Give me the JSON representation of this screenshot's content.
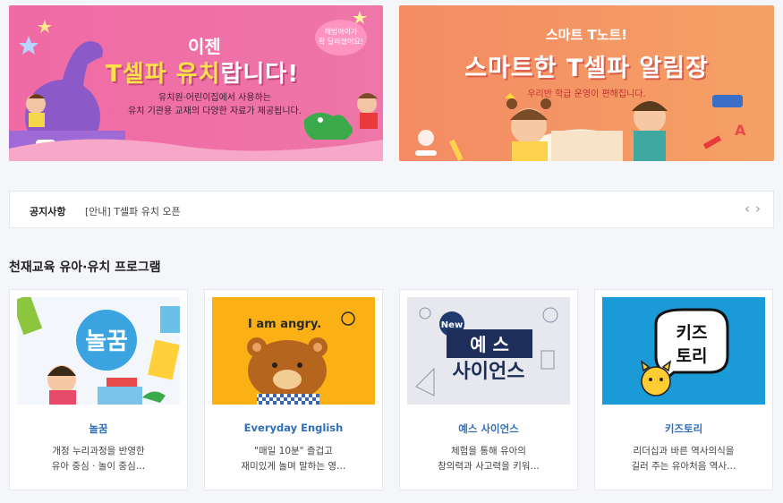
{
  "banners": {
    "left": {
      "top_line": "이젠",
      "title_highlight": "T셀파 유치",
      "title_rest": "랍니다!",
      "desc_line1": "유치원·어린이집에서 사용하는",
      "desc_line2": "유치 기관용 교재의 다양한 자료가 제공됩니다.",
      "badge_line1": "해법아이가",
      "badge_line2": "확 달라졌어요!"
    },
    "right": {
      "top_line": "스마트 T노트!",
      "title": "스마트한 T셀파 알림장",
      "desc": "우리반 학급 운영이 편해집니다."
    }
  },
  "notice": {
    "label": "공지사항",
    "text": "[안내] T셀파 유치 오픈",
    "prev": "‹",
    "next": "›"
  },
  "section": {
    "title": "천재교육 유아·유치 프로그램"
  },
  "cards": [
    {
      "title": "놀꿈",
      "desc1": "개정 누리과정을 반영한",
      "desc2": "유아 중심 · 놀이 중심…",
      "thumb_text": "놀꿈"
    },
    {
      "title": "Everyday English",
      "desc1": "\"매일 10분\" 즐겁고",
      "desc2": "재미있게 놀며 말하는 영…",
      "thumb_text": "I am angry."
    },
    {
      "title": "예스 사이언스",
      "desc1": "체험을 통해 유아의",
      "desc2": "창의력과 사고력을 키워…",
      "thumb_badge": "New",
      "thumb_text1": "예 스",
      "thumb_text2": "사이언스"
    },
    {
      "title": "키즈토리",
      "desc1": "리더십과 바른 역사의식을",
      "desc2": "길러 주는 유아처음 역사…",
      "thumb_text1": "키즈",
      "thumb_text2": "토리"
    }
  ],
  "colors": {
    "left_banner": "#ef6fa6",
    "right_banner": "#f59566",
    "card_title": "#2f6fb8",
    "kidstory_bg": "#1b9ad8",
    "english_bg": "#fbb116",
    "science_bg": "#e6e8ee"
  }
}
